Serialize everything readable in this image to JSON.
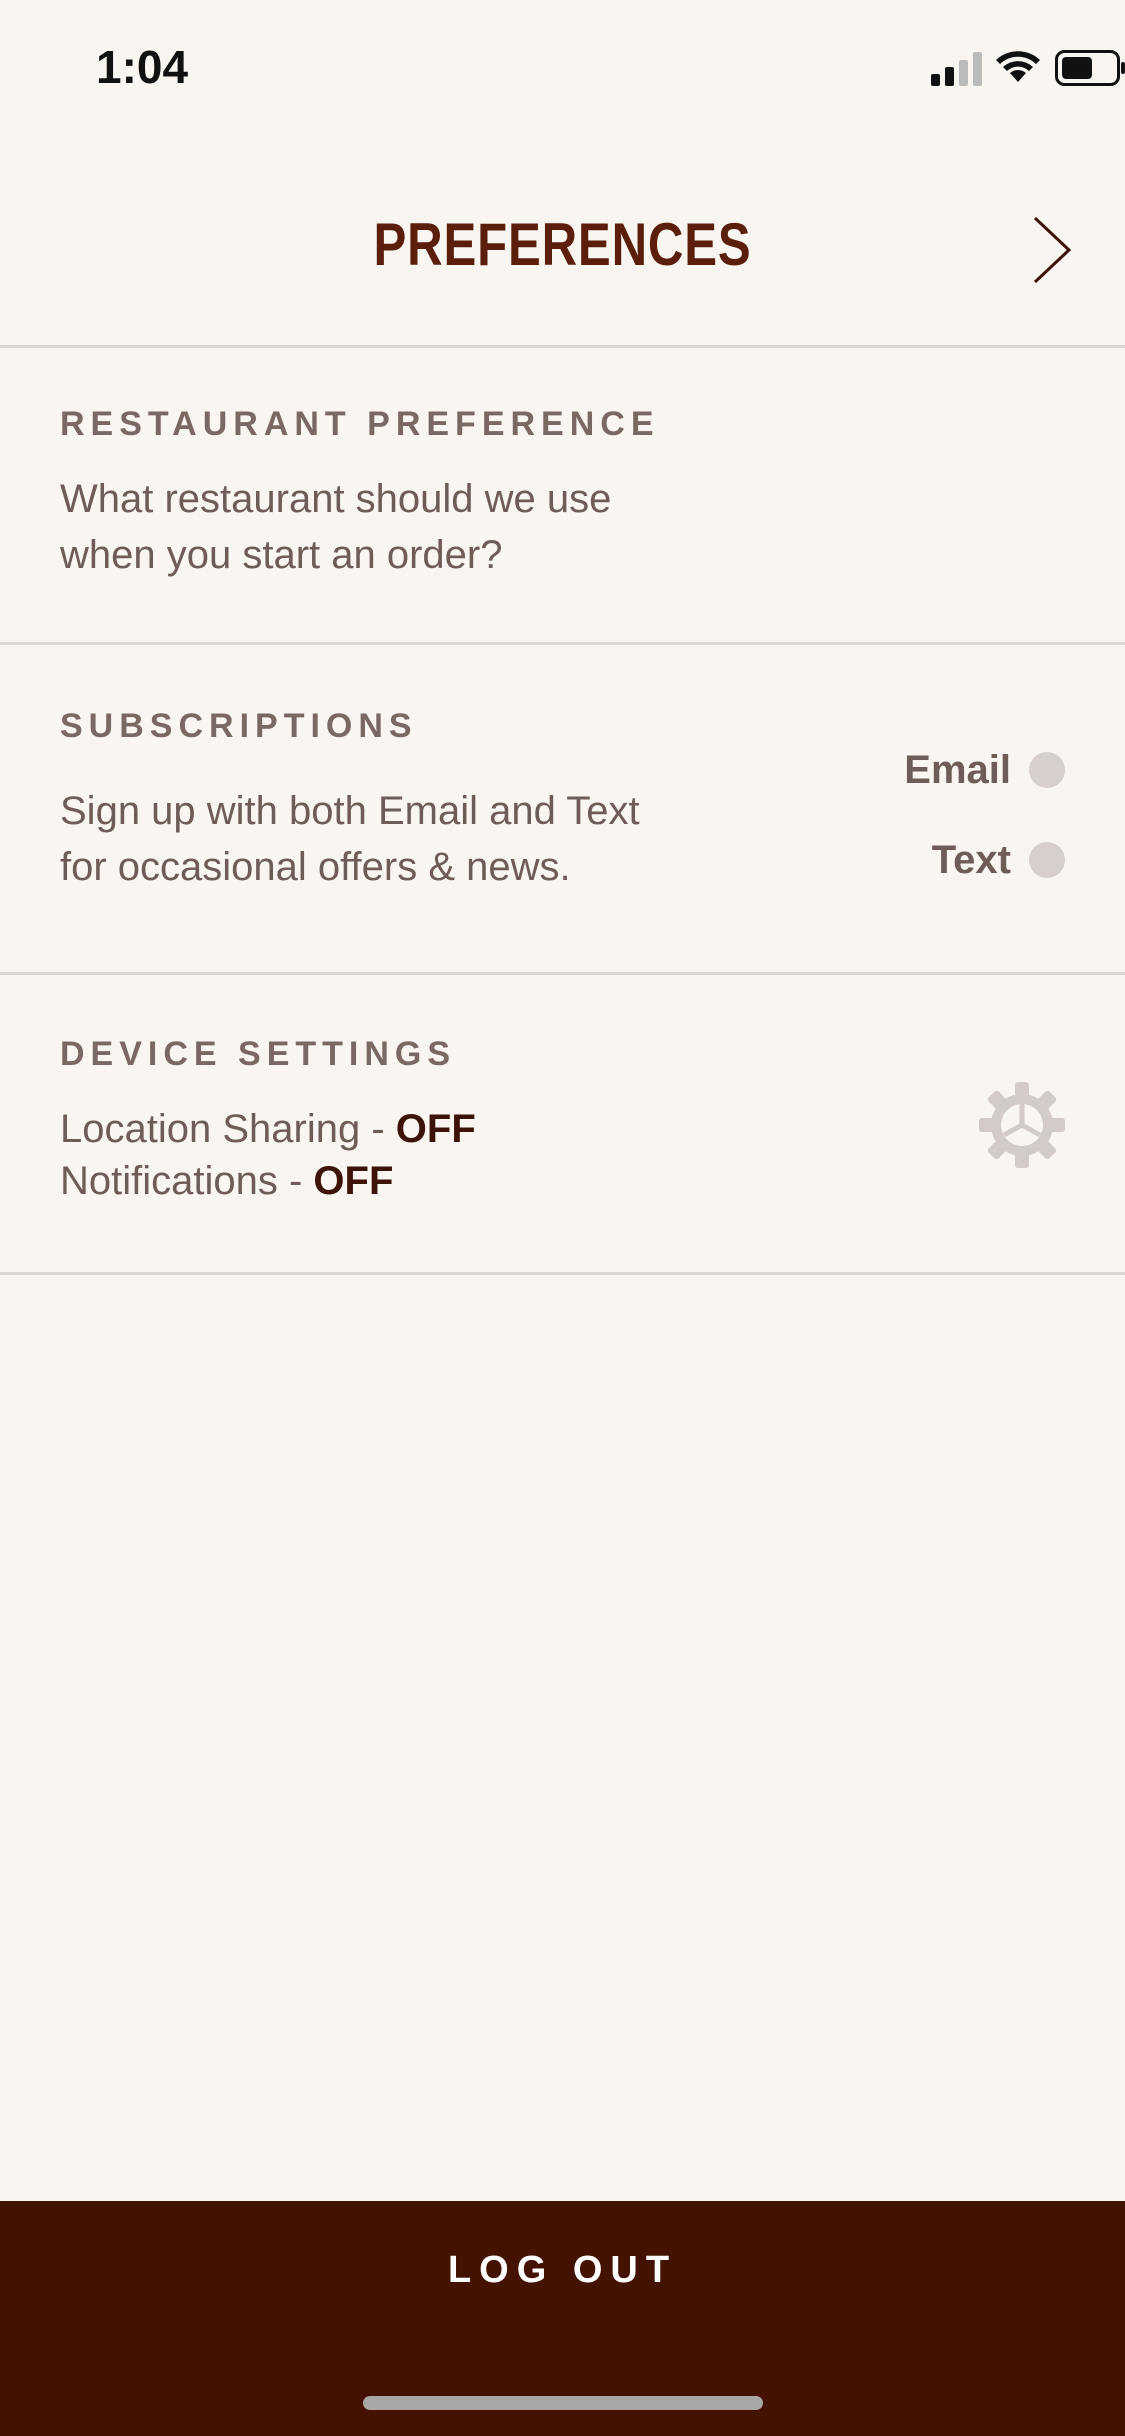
{
  "status_bar": {
    "time": "1:04"
  },
  "header": {
    "title": "PREFERENCES"
  },
  "restaurant_preference": {
    "heading": "RESTAURANT PREFERENCE",
    "line1": "What restaurant should we use",
    "line2": "when you start an order?"
  },
  "subscriptions": {
    "heading": "SUBSCRIPTIONS",
    "line1": "Sign up with both Email and Text",
    "line2": "for occasional offers & news.",
    "email_label": "Email",
    "text_label": "Text"
  },
  "device_settings": {
    "heading": "DEVICE SETTINGS",
    "location_label": "Location Sharing - ",
    "location_value": "OFF",
    "notifications_label": "Notifications - ",
    "notifications_value": "OFF"
  },
  "footer": {
    "logout_label": "LOG OUT"
  },
  "icons": {
    "forward": "chevron-right-icon",
    "settings": "gear-icon"
  },
  "colors": {
    "title": "#5a1e0a",
    "logout_bar": "#431200",
    "background": "#f9f6f2",
    "toggle_off": "#d6cfcc"
  }
}
